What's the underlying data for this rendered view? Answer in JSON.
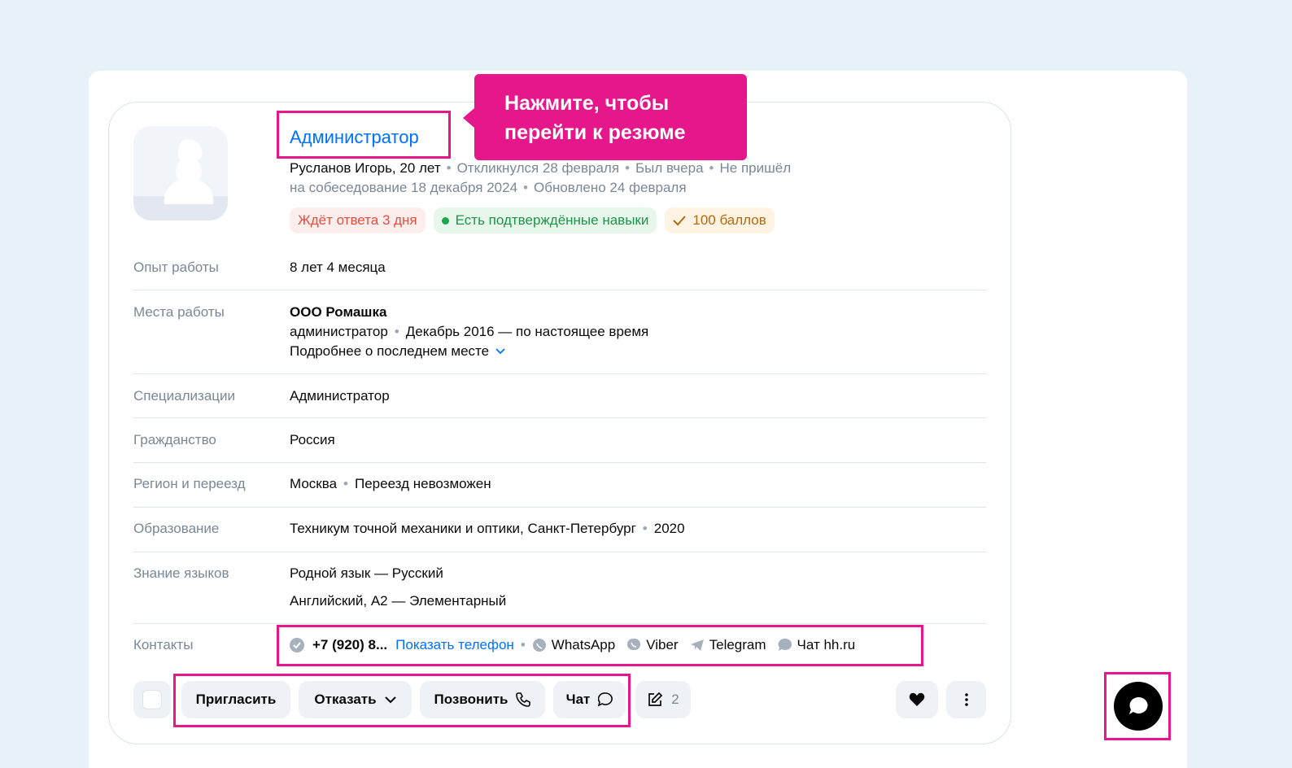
{
  "resume": {
    "title": "Администратор",
    "tooltip": {
      "line1": "Нажмите, чтобы",
      "line2": "перейти к резюме"
    },
    "meta_line1": {
      "name": "Русланов Игорь, 20 лет",
      "responded": "Откликнулся 28 февраля",
      "last_seen": "Был вчера",
      "no_show_a": "Не пришёл"
    },
    "meta_line2": {
      "no_show_b": "на собеседование 18 декабря 2024",
      "updated": "Обновлено 24 февраля"
    },
    "badges": {
      "waiting": "Ждёт ответа 3 дня",
      "skills": "Есть подтверждённые навыки",
      "score": "100 баллов"
    }
  },
  "fields": {
    "experience": {
      "label": "Опыт работы",
      "value": "8 лет 4 месяца"
    },
    "workplaces": {
      "label": "Места работы",
      "company": "ООО Ромашка",
      "position": "администратор",
      "period": "Декабрь 2016 — по настоящее время",
      "more_link": "Подробнее о последнем месте"
    },
    "specializations": {
      "label": "Специализации",
      "value": "Администратор"
    },
    "citizenship": {
      "label": "Гражданство",
      "value": "Россия"
    },
    "region": {
      "label": "Регион и переезд",
      "city": "Москва",
      "relocation": "Переезд невозможен"
    },
    "education": {
      "label": "Образование",
      "institution": "Техникум точной механики и оптики, Санкт-Петербург",
      "year": "2020"
    },
    "languages": {
      "label": "Знание языков",
      "native": "Родной язык — Русский",
      "english": "Английский, A2 — Элементарный"
    },
    "contacts": {
      "label": "Контакты",
      "phone": "+7 (920) 8...",
      "show_phone": "Показать телефон",
      "whatsapp": "WhatsApp",
      "viber": "Viber",
      "telegram": "Telegram",
      "chat": "Чат hh.ru"
    }
  },
  "actions": {
    "invite": "Пригласить",
    "reject": "Отказать",
    "call": "Позвонить",
    "chat": "Чат",
    "notes_count": "2"
  },
  "colors": {
    "accent": "#0070ff",
    "highlight": "#e6178a",
    "label": "#7a8796"
  },
  "icons": [
    "avatar-placeholder-icon",
    "check-icon",
    "chevron-down-icon",
    "verified-icon",
    "whatsapp-icon",
    "viber-icon",
    "telegram-icon",
    "chat-bubble-icon",
    "phone-icon",
    "edit-icon",
    "heart-icon",
    "more-vertical-icon"
  ]
}
